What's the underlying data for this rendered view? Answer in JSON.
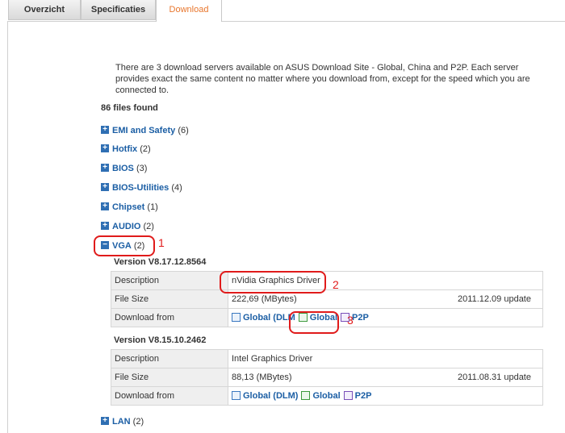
{
  "tabs": [
    {
      "label": "Overzicht"
    },
    {
      "label": "Specificaties"
    },
    {
      "label": "Download",
      "active": true
    }
  ],
  "intro": "There are 3 download servers available on ASUS Download Site - Global, China and P2P. Each server provides exact the same content no matter where you download from, except for the speed which you are connected to.",
  "files_found": "86 files found",
  "categories": [
    {
      "name": "EMI and Safety",
      "count": "(6)",
      "icon": "+"
    },
    {
      "name": "Hotfix",
      "count": "(2)",
      "icon": "+"
    },
    {
      "name": "BIOS",
      "count": "(3)",
      "icon": "+"
    },
    {
      "name": "BIOS-Utilities",
      "count": "(4)",
      "icon": "+"
    },
    {
      "name": "Chipset",
      "count": "(1)",
      "icon": "+"
    },
    {
      "name": "AUDIO",
      "count": "(2)",
      "icon": "+"
    },
    {
      "name": "VGA",
      "count": "(2)",
      "icon": "−"
    },
    {
      "name": "LAN",
      "count": "(2)",
      "icon": "+"
    }
  ],
  "versions": [
    {
      "version": "Version  V8.17.12.8564",
      "description_label": "Description",
      "description": "nVidia Graphics Driver",
      "size_label": "File Size",
      "size": "222,69  (MBytes)",
      "date": "2011.12.09  update",
      "download_label": "Download from",
      "links": [
        "Global (DLM",
        "Global",
        "P2P"
      ]
    },
    {
      "version": "Version  V8.15.10.2462",
      "description_label": "Description",
      "description": "Intel Graphics Driver",
      "size_label": "File Size",
      "size": "88,13  (MBytes)",
      "date": "2011.08.31  update",
      "download_label": "Download from",
      "links": [
        "Global (DLM)",
        "Global",
        "P2P"
      ]
    }
  ],
  "annotations": [
    "1",
    "2",
    "3"
  ],
  "colors": {
    "accent": "#e8762d",
    "link": "#1b5ea4",
    "expander": "#2f6fb3",
    "annotation": "#e01b1b"
  }
}
